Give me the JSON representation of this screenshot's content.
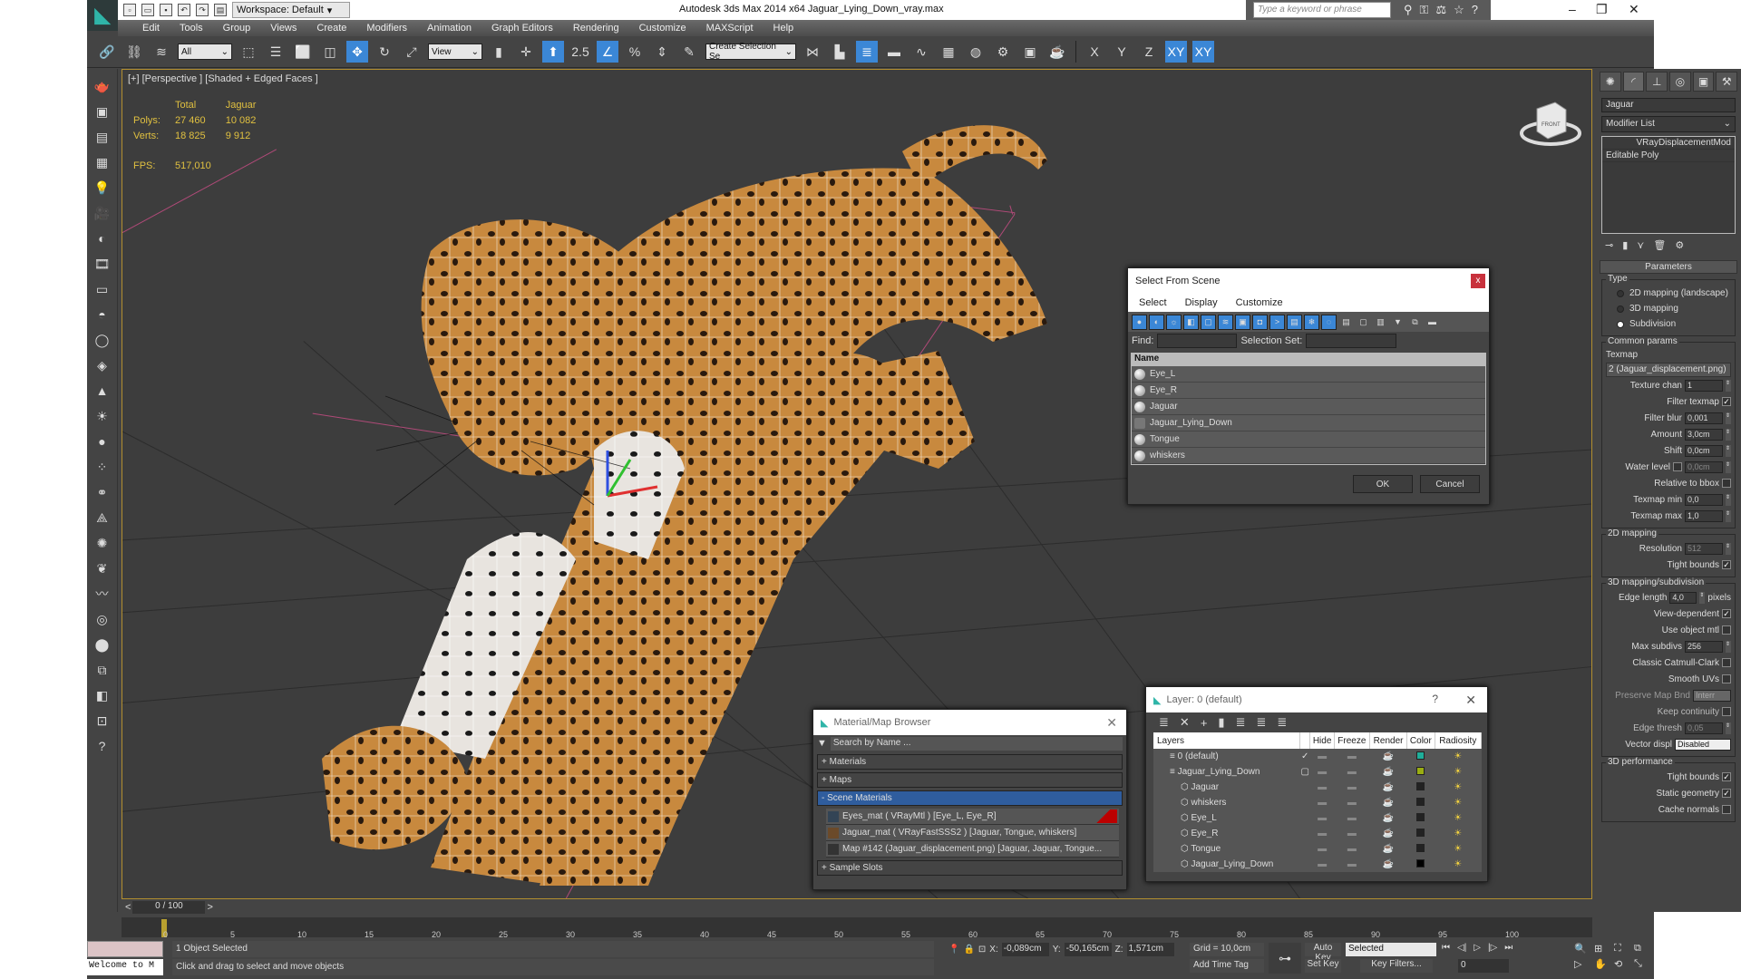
{
  "titlebar": {
    "workspace": "Workspace: Default",
    "title": "Autodesk 3ds Max  2014 x64     Jaguar_Lying_Down_vray.max",
    "search_placeholder": "Type a keyword or phrase",
    "window_buttons": [
      "minimize-icon",
      "restore-icon",
      "close-icon"
    ]
  },
  "menu": [
    "Edit",
    "Tools",
    "Group",
    "Views",
    "Create",
    "Modifiers",
    "Animation",
    "Graph Editors",
    "Rendering",
    "Customize",
    "MAXScript",
    "Help"
  ],
  "toolbar": {
    "selection_filter": "All",
    "reference_coord": "View",
    "snap_value": "2.5",
    "named_selection_placeholder": "Create Selection Se",
    "axis_buttons": [
      "X",
      "Y",
      "Z",
      "XY",
      "XY"
    ]
  },
  "viewport": {
    "label": "[+] [Perspective ] [Shaded + Edged Faces ]",
    "stats": {
      "headers": [
        "",
        "Total",
        "Jaguar"
      ],
      "polys": [
        "Polys:",
        "27 460",
        "10 082"
      ],
      "verts": [
        "Verts:",
        "18 825",
        "9 912"
      ],
      "fps_label": "FPS:",
      "fps_value": "517,010"
    },
    "viewcube_face": "FRONT"
  },
  "command_panel": {
    "tabs": [
      "create-icon",
      "modify-icon",
      "hierarchy-icon",
      "motion-icon",
      "display-icon",
      "utilities-icon"
    ],
    "object_name": "Jaguar",
    "modifier_list": "Modifier List",
    "stack": [
      "VRayDisplacementMod",
      "Editable Poly"
    ],
    "rollout_title": "Parameters",
    "type_group": "Type",
    "type_options": [
      {
        "label": "2D mapping (landscape)",
        "selected": false
      },
      {
        "label": "3D mapping",
        "selected": false
      },
      {
        "label": "Subdivision",
        "selected": true
      }
    ],
    "common_group": "Common params",
    "texmap_label": "Texmap",
    "texmap_value": "2 (Jaguar_displacement.png)",
    "texture_chan_label": "Texture chan",
    "texture_chan": "1",
    "filter_texmap_label": "Filter texmap",
    "filter_texmap": true,
    "filter_blur_label": "Filter blur",
    "filter_blur": "0,001",
    "amount_label": "Amount",
    "amount": "3,0cm",
    "shift_label": "Shift",
    "shift": "0,0cm",
    "water_level_label": "Water level",
    "water_level": "0,0cm",
    "relative_bbox_label": "Relative to bbox",
    "texmap_min_label": "Texmap min",
    "texmap_min": "0,0",
    "texmap_max_label": "Texmap max",
    "texmap_max": "1,0",
    "mapping2d_group": "2D mapping",
    "resolution_label": "Resolution",
    "resolution": "512",
    "tight_bounds_label": "Tight bounds",
    "mapping3d_group": "3D mapping/subdivision",
    "edge_length_label": "Edge length",
    "edge_length": "4,0",
    "pixels_label": "pixels",
    "view_dependent_label": "View-dependent",
    "use_object_mtl_label": "Use object mtl",
    "max_subdivs_label": "Max subdivs",
    "max_subdivs": "256",
    "catmull_label": "Classic Catmull-Clark",
    "smooth_uvs_label": "Smooth UVs",
    "preserve_label": "Preserve Map Bnd",
    "preserve_value": "Interr",
    "keep_continuity_label": "Keep continuity",
    "edge_thresh_label": "Edge thresh",
    "edge_thresh": "0,05",
    "vector_displ_label": "Vector displ",
    "vector_displ": "Disabled",
    "perf_group": "3D performance",
    "perf_tight_label": "Tight bounds",
    "static_geom_label": "Static geometry",
    "cache_normals_label": "Cache normals"
  },
  "select_from_scene": {
    "title": "Select From Scene",
    "close": "x",
    "menu": [
      "Select",
      "Display",
      "Customize"
    ],
    "find_label": "Find:",
    "selection_set_label": "Selection Set:",
    "column": "Name",
    "items": [
      "Eye_L",
      "Eye_R",
      "Jaguar",
      "Jaguar_Lying_Down",
      "Tongue",
      "whiskers"
    ],
    "ok": "OK",
    "cancel": "Cancel"
  },
  "material_browser": {
    "title": "Material/Map Browser",
    "search_placeholder": "Search by Name ...",
    "sections": [
      "+ Materials",
      "+ Maps",
      "- Scene Materials"
    ],
    "scene_materials": [
      "Eyes_mat  ( VRayMtl ) [Eye_L, Eye_R]",
      "Jaguar_mat  ( VRayFastSSS2 ) [Jaguar, Tongue, whiskers]",
      "Map #142 (Jaguar_displacement.png) [Jaguar, Jaguar, Tongue..."
    ],
    "sample_slots": "+ Sample Slots"
  },
  "layer_dialog": {
    "title": "Layer: 0 (default)",
    "help": "?",
    "columns": [
      "Layers",
      "",
      "Hide",
      "Freeze",
      "Render",
      "Color",
      "Radiosity"
    ],
    "rows": [
      {
        "name": "0 (default)",
        "indent": 1,
        "current": "✓",
        "color": "#1fae9a"
      },
      {
        "name": "Jaguar_Lying_Down",
        "indent": 1,
        "current": "▢",
        "color": "#9aad12"
      },
      {
        "name": "Jaguar",
        "indent": 2,
        "current": "",
        "color": "#222222"
      },
      {
        "name": "whiskers",
        "indent": 2,
        "current": "",
        "color": "#222222"
      },
      {
        "name": "Eye_L",
        "indent": 2,
        "current": "",
        "color": "#222222"
      },
      {
        "name": "Eye_R",
        "indent": 2,
        "current": "",
        "color": "#222222"
      },
      {
        "name": "Tongue",
        "indent": 2,
        "current": "",
        "color": "#222222"
      },
      {
        "name": "Jaguar_Lying_Down",
        "indent": 2,
        "current": "",
        "color": "#000000"
      }
    ]
  },
  "timeline": {
    "slider_label": "0 / 100",
    "current_frame": 0,
    "ticks": [
      "0",
      "5",
      "10",
      "15",
      "20",
      "25",
      "30",
      "35",
      "40",
      "45",
      "50",
      "55",
      "60",
      "65",
      "70",
      "75",
      "80",
      "85",
      "90",
      "95",
      "100"
    ]
  },
  "statusbar": {
    "maxscript_listener": "Welcome to M",
    "status": "1 Object Selected",
    "prompt": "Click and drag to select and move objects",
    "x_label": "X:",
    "x": "-0,089cm",
    "y_label": "Y:",
    "y": "-50,165cm",
    "z_label": "Z:",
    "z": "1,571cm",
    "grid": "Grid = 10,0cm",
    "add_time_tag": "Add Time Tag",
    "auto_key": "Auto Key",
    "set_key": "Set Key",
    "selected": "Selected",
    "key_filters": "Key Filters...",
    "frame": "0"
  },
  "colors": {
    "accent_blue": "#3b87d6",
    "viewport_border": "#b38f2f",
    "stats_yellow": "#e0c040",
    "scene_materials_highlight": "#2f5d9e"
  }
}
